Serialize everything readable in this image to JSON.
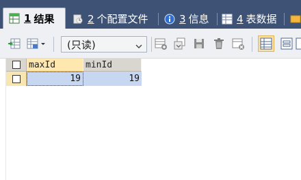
{
  "tabs": [
    {
      "number": "1",
      "label": "结果",
      "active": true,
      "icon": "result-table-icon"
    },
    {
      "number": "2",
      "label": "个配置文件",
      "active": false,
      "icon": "profile-icon"
    },
    {
      "number": "3",
      "label": "信息",
      "active": false,
      "icon": "info-icon"
    },
    {
      "number": "4",
      "label": "表数据",
      "active": false,
      "icon": "table-data-icon"
    }
  ],
  "toolbar": {
    "mode_select": "(只读)",
    "buttons": [
      "export-icon",
      "grid-options-icon",
      "new-row-icon",
      "duplicate-row-icon",
      "save-icon",
      "delete-icon",
      "refresh-icon",
      "grid-view-icon",
      "form-view-icon"
    ]
  },
  "grid": {
    "columns": [
      "maxId",
      "minId"
    ],
    "rows": [
      [
        "19",
        "19"
      ]
    ]
  },
  "colors": {
    "tabbar_bg": "#3d5275",
    "toolbar_bg": "#eef0f4",
    "selected_cell": "#c7d7f2",
    "header_selected": "#ffe7b0"
  }
}
